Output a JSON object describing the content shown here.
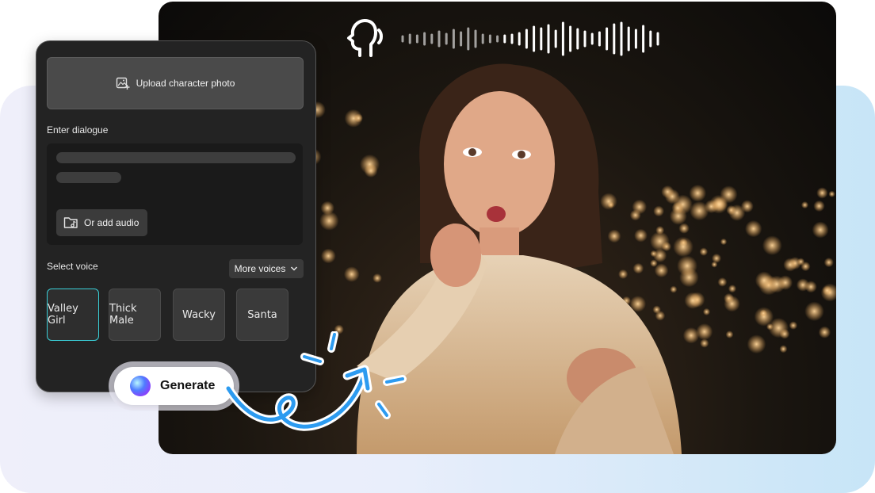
{
  "upload": {
    "label": "Upload character photo"
  },
  "dialogue": {
    "label": "Enter dialogue",
    "add_audio_label": "Or add audio"
  },
  "voice": {
    "label": "Select voice",
    "more_label": "More voices",
    "options": [
      "Valley Girl",
      "Thick Male",
      "Wacky",
      "Santa"
    ],
    "selected": "Valley Girl"
  },
  "generate": {
    "label": "Generate"
  },
  "colors": {
    "accent": "#3ad0d8",
    "arrow": "#2d9bf0",
    "panel": "#232323"
  }
}
